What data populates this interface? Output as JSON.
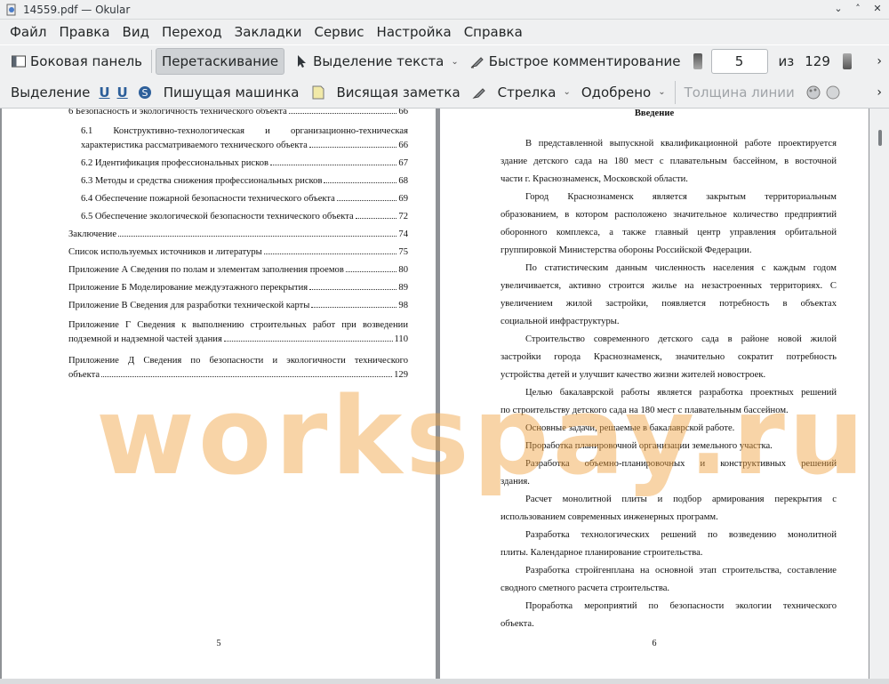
{
  "window": {
    "title": "14559.pdf  — Okular",
    "minimize": "⌄",
    "maximize": "˄",
    "close": "✕"
  },
  "menu": [
    "Файл",
    "Правка",
    "Вид",
    "Переход",
    "Закладки",
    "Сервис",
    "Настройка",
    "Справка"
  ],
  "toolbar1": {
    "sidebar": "Боковая панель",
    "drag": "Перетаскивание",
    "text_select": "Выделение текста",
    "quick_comment": "Быстрое комментирование",
    "page_current": "5",
    "page_of": "из",
    "page_total": "129"
  },
  "toolbar2": {
    "selection": "Выделение",
    "typewriter": "Пишущая машинка",
    "pinned_note": "Висящая заметка",
    "arrow": "Стрелка",
    "approved": "Одобрено",
    "line_width": "Толщина линии"
  },
  "left_page": {
    "toc": [
      {
        "text": "6 Безопасность и экологичность технического объекта",
        "page": "66"
      },
      {
        "text_l1": "6.1      Конструктивно-технологическая      и      организационно-техническая",
        "text_l2": "характеристика рассматриваемого технического объекта",
        "page": "66"
      },
      {
        "text": "6.2 Идентификация профессиональных рисков",
        "page": "67"
      },
      {
        "text": "6.3 Методы и средства снижения профессиональных рисков",
        "page": "68"
      },
      {
        "text": "6.4 Обеспечение пожарной безопасности технического объекта",
        "page": "69"
      },
      {
        "text": "6.5 Обеспечение экологической безопасности технического объекта",
        "page": "72"
      },
      {
        "text": "Заключение",
        "page": "74"
      },
      {
        "text": "Список используемых источников и литературы",
        "page": "75"
      },
      {
        "text": "Приложение А Сведения по полам и элементам заполнения проемов",
        "page": "80"
      },
      {
        "text": "Приложение Б Моделирование междуэтажного перекрытия",
        "page": "89"
      },
      {
        "text": "Приложение В Сведения для разработки технической карты",
        "page": "98"
      },
      {
        "text_l1": "Приложение Г Сведения к выполнению строительных работ при возведении",
        "text_l2": "подземной и надземной частей здания",
        "page": "110"
      },
      {
        "text_l1": "Приложение Д Сведения по безопасности и экологичности технического",
        "text_l2": "объекта",
        "page": "129"
      }
    ],
    "page_number": "5"
  },
  "right_page": {
    "title": "Введение",
    "lines": [
      "В представленной выпускной квалификационной работе проектируется",
      "здание детского сада на 180 мест с плавательным бассейном, в восточной",
      "части г. Краснознаменск, Московской области.",
      "Город   Краснознаменск   является   закрытым   территориальным",
      "образованием, в котором расположено значительное количество предприятий",
      "оборонного комплекса, а также главный центр управления орбитальной",
      "группировкой Министерства обороны Российской Федерации.",
      "По статистическим данным численность населения с каждым годом",
      "увеличивается, активно строится жилье на незастроенных территориях. С",
      "увеличением жилой застройки, появляется потребность в объектах",
      "социальной инфраструктуры.",
      "Строительство современного детского сада в районе новой жилой",
      "застройки города Краснознаменск, значительно сократит потребность",
      "устройства детей и улучшит качество жизни жителей новостроек.",
      "Целью бакалаврской работы является разработка проектных решений",
      "по строительству детского сада на 180 мест с плавательным бассейном.",
      "Основные задачи, решаемые в бакалаврской работе.",
      "Проработка планировочной организации земельного участка.",
      "Разработка   объемно-планировочных   и   конструктивных   решений",
      "здания.",
      "Расчет монолитной плиты и подбор армирования перекрытия с",
      "использованием современных инженерных программ.",
      "Разработка технологических решений по возведению монолитной",
      "плиты. Календарное планирование строительства.",
      "Разработка стройгенплана на основной этап строительства, составление",
      "сводного сметного расчета строительства.",
      "Проработка мероприятий по безопасности экологии технического",
      "объекта."
    ],
    "page_number": "6"
  },
  "watermark": "workspay.ru"
}
